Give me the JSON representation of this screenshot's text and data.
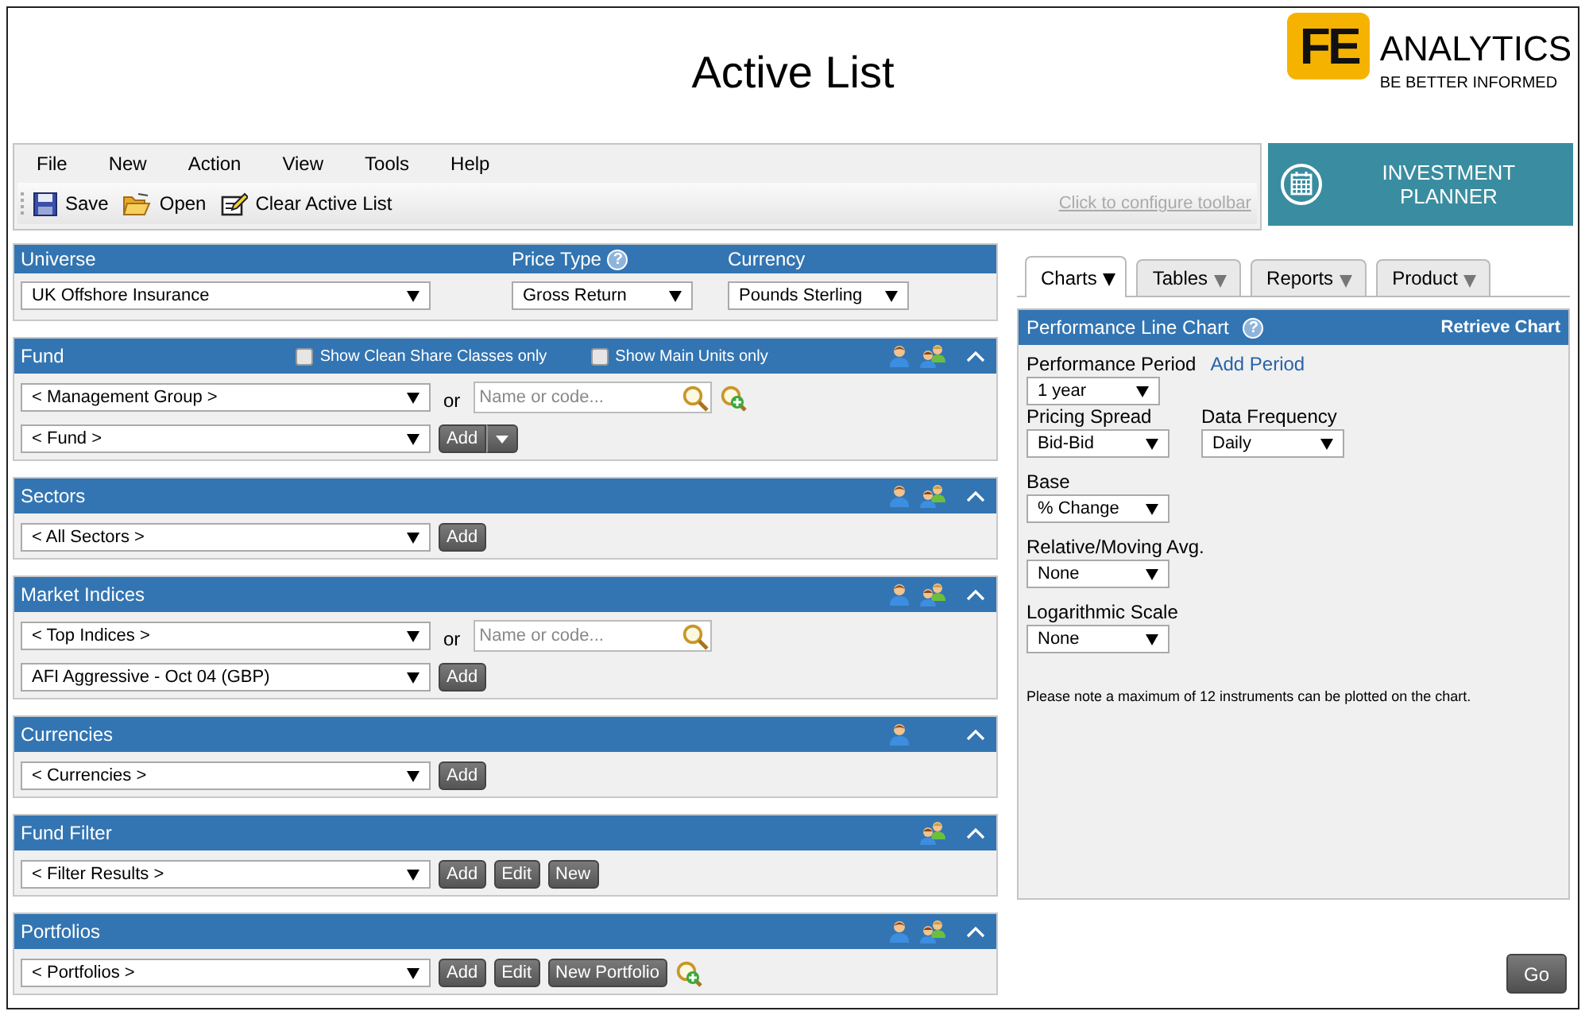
{
  "header": {
    "title": "Active List",
    "logo": {
      "mark": "FE",
      "name": "ANALYTICS",
      "tagline": "BE BETTER INFORMED"
    }
  },
  "menu": [
    "File",
    "New",
    "Action",
    "View",
    "Tools",
    "Help"
  ],
  "toolbar": {
    "items": [
      {
        "kind": "save",
        "label": "Save"
      },
      {
        "kind": "open",
        "label": "Open"
      },
      {
        "kind": "clear",
        "label": "Clear Active List"
      }
    ],
    "configure_link": "Click to configure toolbar"
  },
  "planner_button": "INVESTMENT PLANNER",
  "universe": {
    "fields": [
      {
        "label": "Universe",
        "value": "UK Offshore Insurance"
      },
      {
        "label": "Price Type",
        "help": "?",
        "value": "Gross Return"
      },
      {
        "label": "Currency",
        "value": "Pounds Sterling"
      }
    ]
  },
  "panels": [
    {
      "title": "Fund",
      "options": [
        {
          "label": "Show Clean Share Classes only",
          "checked": false
        },
        {
          "label": "Show Main Units only",
          "checked": false
        }
      ],
      "header_icons": [
        {
          "kind": "person"
        },
        {
          "kind": "group"
        }
      ],
      "rows": [
        {
          "controls": [
            {
              "kind": "select",
              "value": "< Management Group >"
            },
            {
              "kind": "or",
              "text": "or"
            },
            {
              "kind": "search",
              "placeholder": "Name or code..."
            },
            {
              "kind": "add_search"
            }
          ]
        },
        {
          "controls": [
            {
              "kind": "select",
              "value": "< Fund >"
            },
            {
              "kind": "split_button",
              "label": "Add"
            }
          ]
        }
      ]
    },
    {
      "title": "Sectors",
      "header_icons": [
        {
          "kind": "person"
        },
        {
          "kind": "group"
        }
      ],
      "rows": [
        {
          "controls": [
            {
              "kind": "select",
              "value": "< All Sectors >"
            },
            {
              "kind": "button",
              "label": "Add"
            }
          ]
        }
      ]
    },
    {
      "title": "Market Indices",
      "header_icons": [
        {
          "kind": "person"
        },
        {
          "kind": "group"
        }
      ],
      "rows": [
        {
          "controls": [
            {
              "kind": "select",
              "value": "< Top Indices >"
            },
            {
              "kind": "or",
              "text": "or"
            },
            {
              "kind": "search",
              "placeholder": "Name or code..."
            }
          ]
        },
        {
          "controls": [
            {
              "kind": "select",
              "value": "AFI Aggressive - Oct 04 (GBP)"
            },
            {
              "kind": "button",
              "label": "Add"
            }
          ]
        }
      ]
    },
    {
      "title": "Currencies",
      "header_icons": [
        {
          "kind": "person"
        }
      ],
      "rows": [
        {
          "controls": [
            {
              "kind": "select",
              "value": "< Currencies >"
            },
            {
              "kind": "button",
              "label": "Add"
            }
          ]
        }
      ]
    },
    {
      "title": "Fund Filter",
      "header_icons": [
        {
          "kind": "group"
        }
      ],
      "rows": [
        {
          "controls": [
            {
              "kind": "select",
              "value": "< Filter Results >"
            },
            {
              "kind": "button",
              "label": "Add"
            },
            {
              "kind": "button",
              "label": "Edit"
            },
            {
              "kind": "button",
              "label": "New"
            }
          ]
        }
      ]
    },
    {
      "title": "Portfolios",
      "header_icons": [
        {
          "kind": "person"
        },
        {
          "kind": "group"
        }
      ],
      "rows": [
        {
          "controls": [
            {
              "kind": "select",
              "value": "< Portfolios >"
            },
            {
              "kind": "button",
              "label": "Add"
            },
            {
              "kind": "button",
              "label": "Edit"
            },
            {
              "kind": "button",
              "label": "New Portfolio"
            },
            {
              "kind": "add_search"
            }
          ]
        }
      ]
    }
  ],
  "tabs": [
    {
      "label": "Charts",
      "selected": true
    },
    {
      "label": "Tables",
      "selected": false
    },
    {
      "label": "Reports",
      "selected": false
    },
    {
      "label": "Product",
      "selected": false
    }
  ],
  "chart_panel": {
    "title": "Performance Line Chart",
    "help": "?",
    "action": "Retrieve Chart",
    "rows": [
      {
        "fields": [
          {
            "label": "Performance Period",
            "link": "Add Period",
            "value": "1 year"
          }
        ]
      },
      {
        "fields": [
          {
            "label": "Pricing Spread",
            "value": "Bid-Bid"
          },
          {
            "label": "Data Frequency",
            "value": "Daily"
          }
        ]
      },
      {
        "fields": [
          {
            "label": "Base",
            "value": "% Change"
          }
        ]
      },
      {
        "fields": [
          {
            "label": "Relative/Moving Avg.",
            "value": "None"
          }
        ]
      },
      {
        "fields": [
          {
            "label": "Logarithmic Scale",
            "value": "None"
          }
        ]
      }
    ],
    "note": "Please note a maximum of 12 instruments can be plotted on the chart."
  },
  "go_button": "Go"
}
